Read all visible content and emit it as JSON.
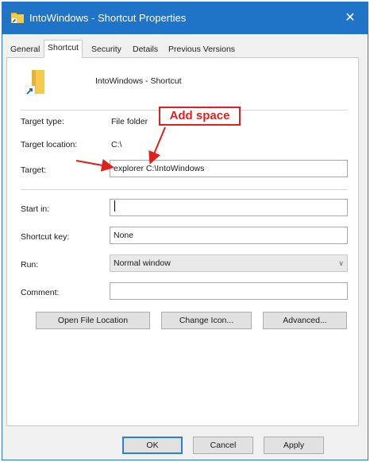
{
  "window": {
    "title": "IntoWindows - Shortcut Properties",
    "close_label": "✕",
    "accent_color": "#1f74c7"
  },
  "tabs": [
    {
      "label": "General"
    },
    {
      "label": "Shortcut",
      "active": true
    },
    {
      "label": "Security"
    },
    {
      "label": "Details"
    },
    {
      "label": "Previous Versions"
    }
  ],
  "shortcut": {
    "name": "IntoWindows - Shortcut",
    "icon": "folder-shortcut-icon"
  },
  "fields": {
    "target_type_label": "Target type:",
    "target_type_value": "File folder",
    "target_location_label": "Target location:",
    "target_location_value": "C:\\",
    "target_label": "Target:",
    "target_value": "explorer C:\\IntoWindows",
    "start_in_label": "Start in:",
    "start_in_value": "",
    "shortcut_key_label": "Shortcut key:",
    "shortcut_key_value": "None",
    "run_label": "Run:",
    "run_value": "Normal window",
    "comment_label": "Comment:",
    "comment_value": ""
  },
  "buttons": {
    "open_file_location": "Open File Location",
    "change_icon": "Change Icon...",
    "advanced": "Advanced...",
    "ok": "OK",
    "cancel": "Cancel",
    "apply": "Apply"
  },
  "annotation": {
    "text": "Add space",
    "color": "#e0201f"
  }
}
